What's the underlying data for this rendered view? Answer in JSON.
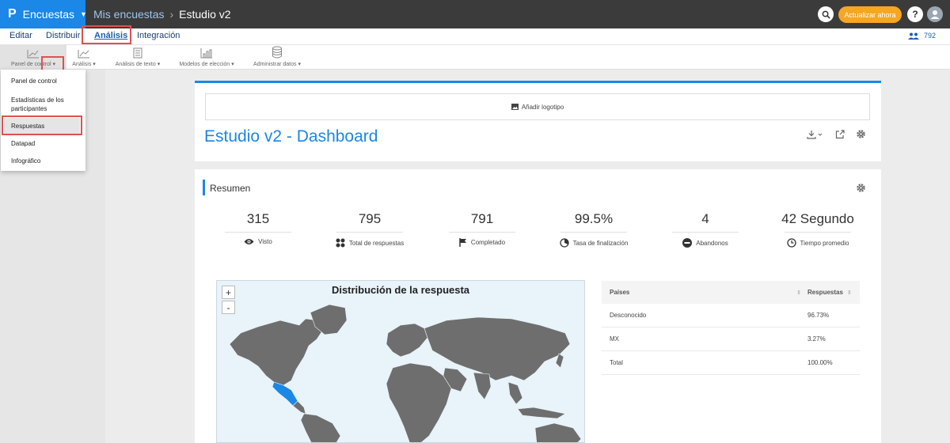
{
  "app": {
    "brand": "Encuestas",
    "breadcrumb": [
      "Mis encuestas",
      "Estudio v2"
    ],
    "upgrade_label": "Actualizar ahora",
    "help_label": "?"
  },
  "menu": {
    "items": [
      {
        "label": "Editar"
      },
      {
        "label": "Distribuir"
      },
      {
        "label": "Análisis",
        "active": true
      },
      {
        "label": "Integración"
      }
    ],
    "count": "792"
  },
  "toolbar": {
    "items": [
      {
        "label": "Panel de control",
        "icon": "line-chart-icon"
      },
      {
        "label": "Análisis",
        "icon": "line-chart-icon"
      },
      {
        "label": "Análisis de texto",
        "icon": "text-grid-icon"
      },
      {
        "label": "Modelos de elección",
        "icon": "bar-chart-icon"
      },
      {
        "label": "Administrar datos",
        "icon": "database-icon"
      }
    ]
  },
  "dropdown": {
    "items": [
      {
        "label": "Panel de control"
      },
      {
        "label": "Estadísticas de los participantes"
      },
      {
        "label": "Respuestas",
        "selected": true
      },
      {
        "label": "Datapad"
      },
      {
        "label": "Infográfico"
      }
    ]
  },
  "dashboard": {
    "add_logo": "Añadir logotipo",
    "title": "Estudio v2 - Dashboard"
  },
  "summary": {
    "title": "Resumen",
    "stats": [
      {
        "value": "315",
        "label": "Visto",
        "icon": "eye-icon"
      },
      {
        "value": "795",
        "label": "Total de respuestas",
        "icon": "grid-dots-icon"
      },
      {
        "value": "791",
        "label": "Completado",
        "icon": "flag-icon"
      },
      {
        "value": "99.5%",
        "label": "Tasa de finalización",
        "icon": "gauge-icon"
      },
      {
        "value": "4",
        "label": "Abandonos",
        "icon": "minus-circle-icon"
      },
      {
        "value": "42 Segundo",
        "label": "Tiempo promedio",
        "icon": "clock-icon"
      }
    ]
  },
  "map": {
    "title": "Distribución de la respuesta",
    "zoom_in": "+",
    "zoom_out": "-",
    "colors": {
      "land": "#6e6e6e",
      "highlight": "#1b87e6",
      "water": "#e8f3fa"
    }
  },
  "table": {
    "headers": [
      "Países",
      "Respuestas"
    ],
    "rows": [
      [
        "Desconocido",
        "96.73%"
      ],
      [
        "MX",
        "3.27%"
      ],
      [
        "Total",
        "100.00%"
      ]
    ]
  }
}
